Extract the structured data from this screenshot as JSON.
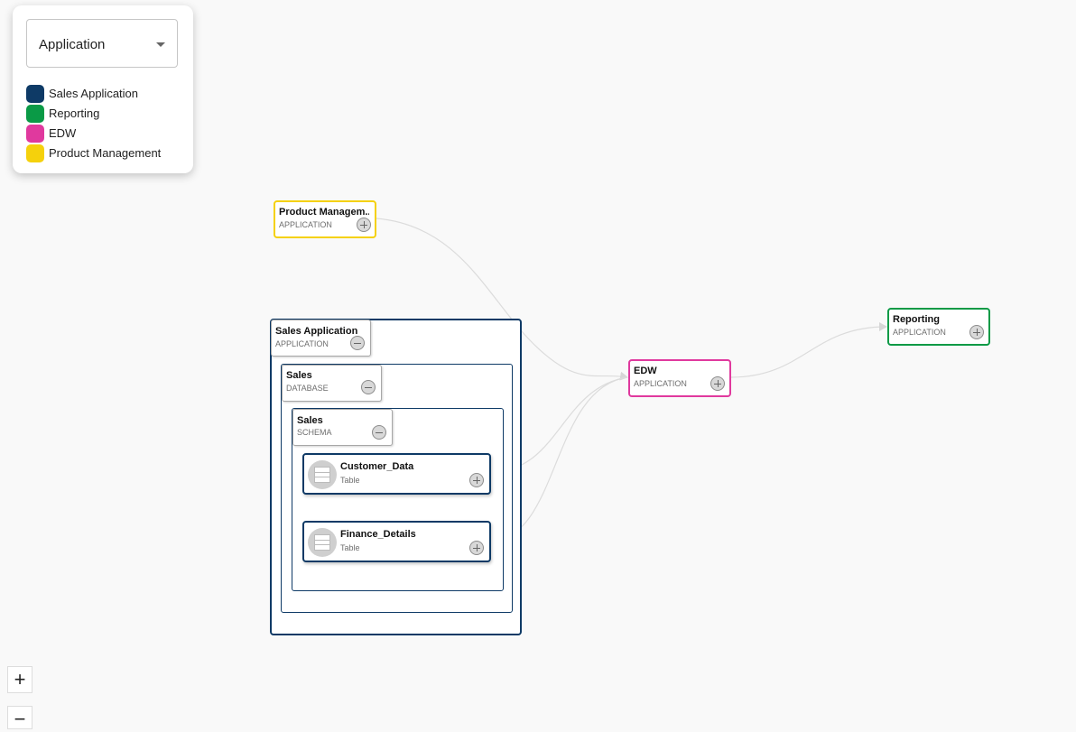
{
  "filter": {
    "selected": "Application",
    "legend": [
      {
        "label": "Sales Application",
        "color": "#0e3a66"
      },
      {
        "label": "Reporting",
        "color": "#0a9a46"
      },
      {
        "label": "EDW",
        "color": "#e0399e"
      },
      {
        "label": "Product Management",
        "color": "#f5d10c"
      }
    ]
  },
  "nodes": {
    "product_management": {
      "title": "Product Managem...",
      "type": "APPLICATION",
      "color": "#f5d10c"
    },
    "sales_application": {
      "title": "Sales Application",
      "type": "APPLICATION"
    },
    "sales_database": {
      "title": "Sales",
      "type": "DATABASE"
    },
    "sales_schema": {
      "title": "Sales",
      "type": "SCHEMA"
    },
    "customer_data": {
      "title": "Customer_Data",
      "type": "Table"
    },
    "finance_details": {
      "title": "Finance_Details",
      "type": "Table"
    },
    "edw": {
      "title": "EDW",
      "type": "APPLICATION",
      "color": "#e0399e"
    },
    "reporting": {
      "title": "Reporting",
      "type": "APPLICATION",
      "color": "#0a9a46"
    }
  },
  "edges": [
    {
      "from": "product_management",
      "to": "edw"
    },
    {
      "from": "customer_data",
      "to": "edw"
    },
    {
      "from": "finance_details",
      "to": "edw"
    },
    {
      "from": "edw",
      "to": "reporting"
    }
  ],
  "zoom": {
    "in_label": "+",
    "out_label": "−"
  }
}
